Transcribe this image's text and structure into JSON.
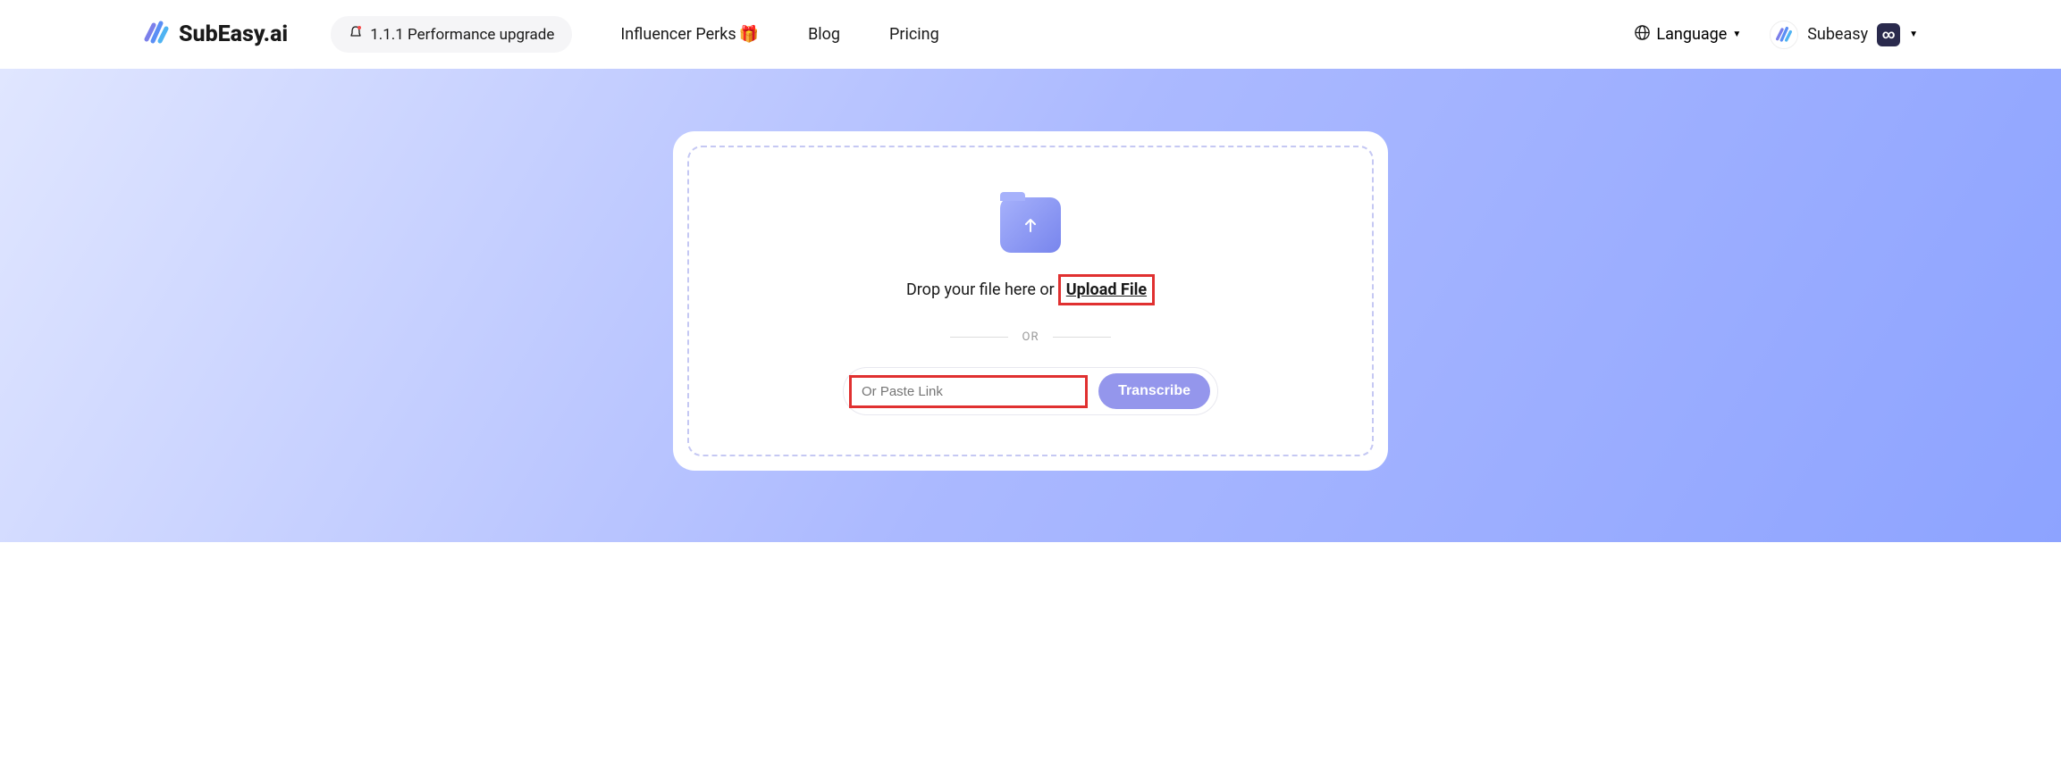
{
  "header": {
    "brand": "SubEasy.ai",
    "announcement": "1.1.1 Performance upgrade",
    "nav": {
      "influencer": "Influencer Perks",
      "blog": "Blog",
      "pricing": "Pricing"
    },
    "language_label": "Language",
    "user_name": "Subeasy",
    "plan_badge": "∞"
  },
  "upload": {
    "drop_prefix": "Drop your file here or",
    "upload_file": "Upload File",
    "or": "OR",
    "paste_placeholder": "Or Paste Link",
    "transcribe": "Transcribe"
  }
}
